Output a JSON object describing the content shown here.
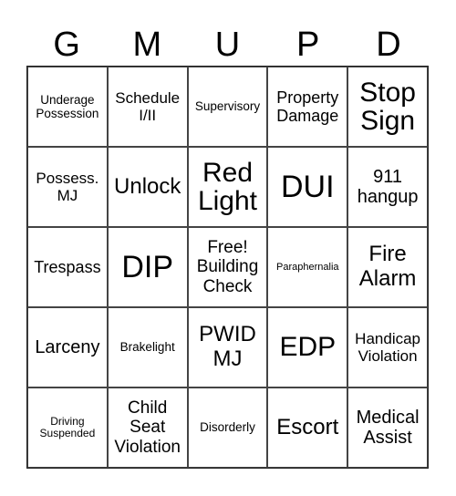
{
  "header": {
    "letters": [
      "G",
      "M",
      "U",
      "P",
      "D"
    ]
  },
  "cells": [
    [
      "Underage Possession",
      "Schedule I/II",
      "Supervisory",
      "Property Damage",
      "Stop Sign"
    ],
    [
      "Possess. MJ",
      "Unlock",
      "Red Light",
      "DUI",
      "911 hangup"
    ],
    [
      "Trespass",
      "DIP",
      "Free! Building Check",
      "Paraphernalia",
      "Fire Alarm"
    ],
    [
      "Larceny",
      "Brakelight",
      "PWID MJ",
      "EDP",
      "Handicap Violation"
    ],
    [
      "Driving Suspended",
      "Child Seat Violation",
      "Disorderly",
      "Escort",
      "Medical Assist"
    ]
  ]
}
